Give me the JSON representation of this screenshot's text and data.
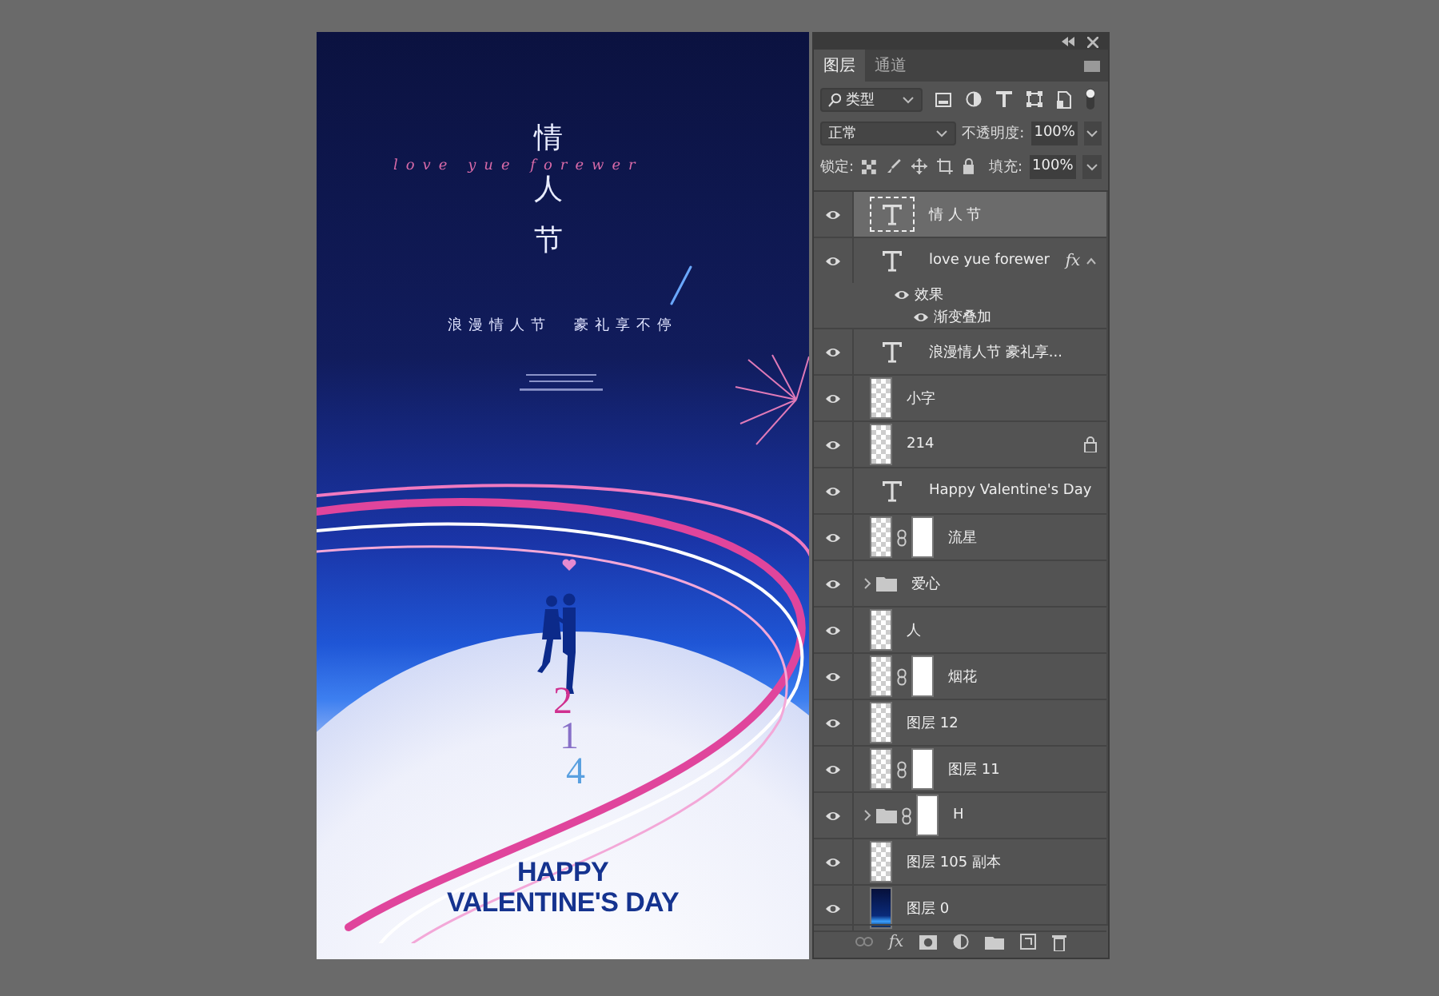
{
  "poster": {
    "title": "情人节",
    "script": "love yue forewer",
    "subtitle": "浪漫情人节  豪礼享不停",
    "digits": [
      "2",
      "1",
      "4"
    ],
    "headline": [
      "HAPPY",
      "VALENTINE'S DAY"
    ]
  },
  "panel": {
    "tabs": [
      {
        "label": "图层",
        "selected": true
      },
      {
        "label": "通道",
        "selected": false
      }
    ],
    "filter": "类型",
    "blend_mode": "正常",
    "opacity_label": "不透明度:",
    "opacity": "100%",
    "lock_label": "锁定:",
    "fill_label": "填充:",
    "fill": "100%",
    "layers": [
      {
        "kind": "text",
        "name": "情 人 节",
        "visible": true,
        "selected": true,
        "locked": false
      },
      {
        "kind": "text",
        "name": "love yue forewer",
        "visible": true,
        "selected": false,
        "locked": false,
        "fx": "fx",
        "effects": {
          "label": "效果",
          "visible": true,
          "children": [
            {
              "label": "渐变叠加",
              "visible": true
            }
          ]
        }
      },
      {
        "kind": "text",
        "name": "浪漫情人节 豪礼享...",
        "visible": true,
        "selected": false,
        "locked": false
      },
      {
        "kind": "raster",
        "name": "小字",
        "visible": true,
        "selected": false,
        "locked": false
      },
      {
        "kind": "raster",
        "name": "214",
        "visible": true,
        "selected": false,
        "locked": true
      },
      {
        "kind": "text",
        "name": "Happy  Valentine's Day",
        "visible": true,
        "selected": false,
        "locked": false
      },
      {
        "kind": "masked",
        "name": "流星",
        "visible": true,
        "selected": false,
        "locked": false
      },
      {
        "kind": "group",
        "name": "爱心",
        "visible": true,
        "selected": false,
        "locked": false,
        "mask": false
      },
      {
        "kind": "raster",
        "name": "人",
        "visible": true,
        "selected": false,
        "locked": false
      },
      {
        "kind": "masked",
        "name": "烟花",
        "visible": true,
        "selected": false,
        "locked": false
      },
      {
        "kind": "raster",
        "name": "图层 12",
        "visible": true,
        "selected": false,
        "locked": false
      },
      {
        "kind": "masked",
        "name": "图层 11",
        "visible": true,
        "selected": false,
        "locked": false
      },
      {
        "kind": "group",
        "name": "H",
        "visible": true,
        "selected": false,
        "locked": false,
        "mask": true
      },
      {
        "kind": "raster",
        "name": "图层 105 副本",
        "visible": true,
        "selected": false,
        "locked": false
      },
      {
        "kind": "image",
        "name": "图层 0",
        "visible": true,
        "selected": false,
        "locked": false
      }
    ],
    "footer_fx": "fx"
  }
}
